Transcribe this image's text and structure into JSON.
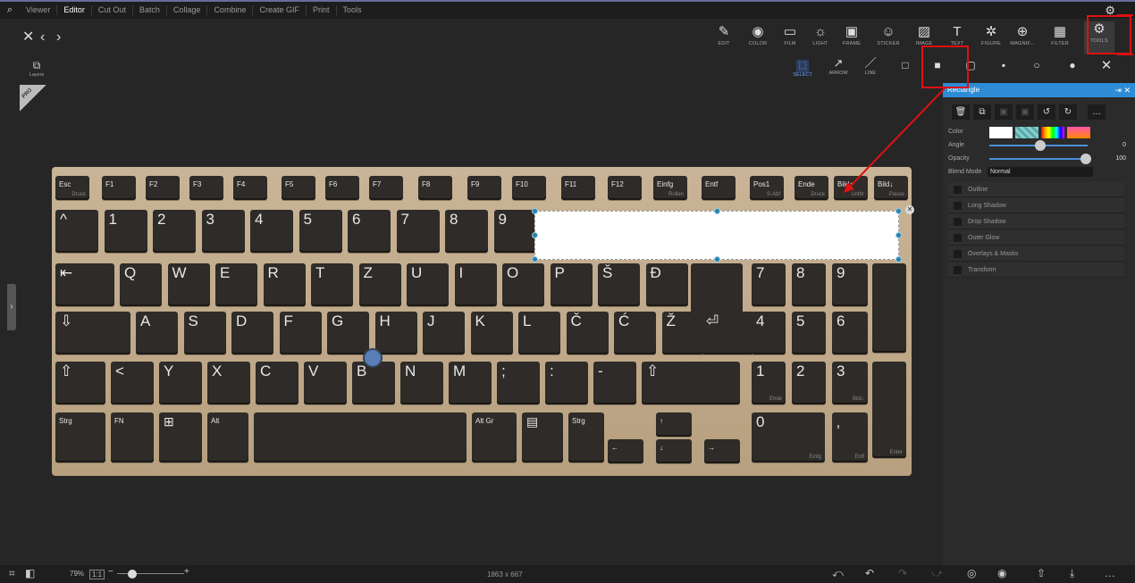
{
  "menu": {
    "items": [
      "Viewer",
      "Editor",
      "Cut Out",
      "Batch",
      "Collage",
      "Combine",
      "Create GIF",
      "Print",
      "Tools"
    ],
    "active": "Editor"
  },
  "toolbar": {
    "tools": [
      {
        "label": "EDIT",
        "icon": "✎"
      },
      {
        "label": "COLOR",
        "icon": "◉"
      },
      {
        "label": "FILM",
        "icon": "▭"
      },
      {
        "label": "LIGHT",
        "icon": "☼"
      },
      {
        "label": "FRAME",
        "icon": "▣"
      },
      {
        "label": "STICKER",
        "icon": "☺"
      },
      {
        "label": "IMAGE",
        "icon": "▨"
      },
      {
        "label": "TEXT",
        "icon": "T"
      },
      {
        "label": "FIGURE",
        "icon": "✲"
      },
      {
        "label": "MAGNIF...",
        "icon": "⊕"
      },
      {
        "label": "FILTER",
        "icon": "▦"
      },
      {
        "label": "TOOLS",
        "icon": "⚙"
      }
    ]
  },
  "subtools": [
    {
      "label": "SELECT",
      "icon": "⬚"
    },
    {
      "label": "ARROW",
      "icon": "↗"
    },
    {
      "label": "LINE",
      "icon": "/"
    }
  ],
  "layers_label": "Layers",
  "pro_badge": "PRO",
  "keyboard": {
    "row0": [
      [
        "Esc",
        "Druck"
      ],
      [
        "F1",
        ""
      ],
      [
        "F2",
        ""
      ],
      [
        "F3",
        ""
      ],
      [
        "F4",
        ""
      ],
      [
        "F5",
        ""
      ],
      [
        "F6",
        ""
      ],
      [
        "F7",
        ""
      ],
      [
        "F8",
        ""
      ],
      [
        "F9",
        ""
      ],
      [
        "F10",
        ""
      ],
      [
        "F11",
        ""
      ],
      [
        "F12",
        ""
      ],
      [
        "Einfg",
        "Rollen"
      ],
      [
        "Entf",
        ""
      ],
      [
        "Pos1",
        "S-Abf"
      ],
      [
        "Ende",
        "Druck"
      ],
      [
        "Bild↑",
        "Untbr"
      ],
      [
        "Bild↓",
        "Pause"
      ]
    ],
    "row1": [
      "^",
      "1",
      "2",
      "3",
      "4",
      "5",
      "6",
      "7",
      "8",
      "9"
    ],
    "row2": [
      "⇤",
      "Q",
      "W",
      "E",
      "R",
      "T",
      "Z",
      "U",
      "I",
      "O",
      "P",
      "Š",
      "Đ",
      "",
      "7",
      "8",
      "9"
    ],
    "row3": [
      "⇩",
      "A",
      "S",
      "D",
      "F",
      "G",
      "H",
      "J",
      "K",
      "L",
      "Č",
      "Ć",
      "Ž",
      "⏎",
      "4",
      "5",
      "6"
    ],
    "row4": [
      "⇧",
      "<",
      "Y",
      "X",
      "C",
      "V",
      "B",
      "N",
      "M",
      ";",
      ":",
      "-",
      "⇧",
      "1",
      "2",
      "3"
    ],
    "row5": [
      "Strg",
      "FN",
      "⊞",
      "Alt",
      "",
      "Alt Gr",
      "▤",
      "Strg",
      "←",
      "↑",
      "↓",
      "→",
      "0",
      "‚"
    ],
    "numpad_sub": {
      "pos1": "Pos1",
      "bild_up": "Bild↑",
      "bild_dn": "Bild↓",
      "ende": "Ende",
      "einfg": "Einfg",
      "entf": "Entf",
      "enter": "Enter"
    }
  },
  "panel": {
    "title": "Rectangle",
    "color_label": "Color",
    "angle_label": "Angle",
    "angle_value": "0",
    "opacity_label": "Opacity",
    "opacity_value": "100",
    "blend_label": "Blend Mode",
    "blend_value": "Normal",
    "opacity_fraction": 1.0,
    "effects": [
      "Outline",
      "Long Shadow",
      "Drop Shadow",
      "Outer Glow",
      "Overlays & Masks",
      "Transform"
    ]
  },
  "bottom": {
    "zoom": "79%",
    "ratio": "1:1",
    "dimensions": "1863 x 667"
  },
  "colors": {
    "accent": "#2e8cd6",
    "annotation": "#e01010"
  }
}
